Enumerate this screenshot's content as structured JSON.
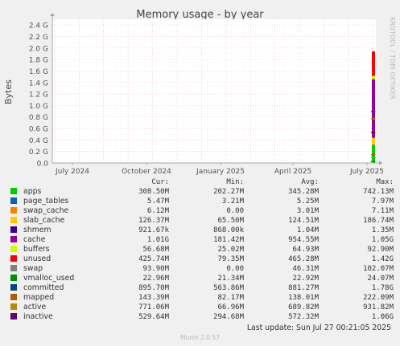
{
  "header": {
    "title": "Memory usage - by year",
    "side_text": "RRDTOOL / TOBI OETIKER",
    "ylabel": "Bytes"
  },
  "colors": {
    "apps": "#00cc00",
    "page_tables": "#0066b3",
    "swap_cache": "#ff8000",
    "slab_cache": "#ffcc00",
    "shmem": "#330099",
    "cache": "#990099",
    "buffers": "#ccff00",
    "unused": "#ff0000",
    "swap": "#808080",
    "vmalloc_used": "#008f00",
    "committed": "#00487d",
    "mapped": "#b35a00",
    "active": "#b38f00",
    "inactive": "#6b006b"
  },
  "chart_data": {
    "type": "area",
    "title": "Memory usage - by year",
    "ylabel": "Bytes",
    "x_ticks": [
      "July 2024",
      "October 2024",
      "January 2025",
      "April 2025",
      "July 2025"
    ],
    "y_ticks": [
      "0.0",
      "0.2 G",
      "0.4 G",
      "0.6 G",
      "0.8 G",
      "1.0 G",
      "1.2 G",
      "1.4 G",
      "1.6 G",
      "1.8 G",
      "2.0 G",
      "2.2 G",
      "2.4 G"
    ],
    "ylim": [
      0,
      2.5
    ],
    "grid": true,
    "note": "Data only present in the last few days of the period; stacked areas appear as a thin spike at the right edge",
    "stacked_series_latest_G": [
      {
        "name": "apps",
        "value": 0.3085
      },
      {
        "name": "page_tables",
        "value": 0.0055
      },
      {
        "name": "swap_cache",
        "value": 0.0061
      },
      {
        "name": "slab_cache",
        "value": 0.1264
      },
      {
        "name": "shmem",
        "value": 0.0009
      },
      {
        "name": "cache",
        "value": 1.01
      },
      {
        "name": "buffers",
        "value": 0.0567
      },
      {
        "name": "unused",
        "value": 0.4257
      }
    ],
    "line_series_latest_G": [
      {
        "name": "swap",
        "value": 0.0939
      },
      {
        "name": "vmalloc_used",
        "value": 0.023
      },
      {
        "name": "committed",
        "value": 0.8957
      },
      {
        "name": "mapped",
        "value": 0.1434
      },
      {
        "name": "active",
        "value": 0.771
      },
      {
        "name": "inactive",
        "value": 0.5296
      }
    ]
  },
  "legend": {
    "headers": [
      "Cur:",
      "Min:",
      "Avg:",
      "Max:"
    ],
    "rows": [
      {
        "name": "apps",
        "color": "#00cc00",
        "cur": "308.50M",
        "min": "202.27M",
        "avg": "345.28M",
        "max": "742.13M"
      },
      {
        "name": "page_tables",
        "color": "#0066b3",
        "cur": "5.47M",
        "min": "3.21M",
        "avg": "5.25M",
        "max": "7.97M"
      },
      {
        "name": "swap_cache",
        "color": "#ff8000",
        "cur": "6.12M",
        "min": "0.00",
        "avg": "3.01M",
        "max": "7.11M"
      },
      {
        "name": "slab_cache",
        "color": "#ffcc00",
        "cur": "126.37M",
        "min": "65.50M",
        "avg": "124.51M",
        "max": "186.74M"
      },
      {
        "name": "shmem",
        "color": "#330099",
        "cur": "921.67k",
        "min": "868.00k",
        "avg": "1.04M",
        "max": "1.35M"
      },
      {
        "name": "cache",
        "color": "#990099",
        "cur": "1.01G",
        "min": "181.42M",
        "avg": "954.55M",
        "max": "1.05G"
      },
      {
        "name": "buffers",
        "color": "#ccff00",
        "cur": "56.68M",
        "min": "25.02M",
        "avg": "64.93M",
        "max": "92.90M"
      },
      {
        "name": "unused",
        "color": "#ff0000",
        "cur": "425.74M",
        "min": "79.35M",
        "avg": "465.28M",
        "max": "1.42G"
      },
      {
        "name": "swap",
        "color": "#808080",
        "cur": "93.90M",
        "min": "0.00",
        "avg": "46.31M",
        "max": "102.07M"
      },
      {
        "name": "vmalloc_used",
        "color": "#008f00",
        "cur": "22.96M",
        "min": "21.34M",
        "avg": "22.92M",
        "max": "24.07M"
      },
      {
        "name": "committed",
        "color": "#00487d",
        "cur": "895.70M",
        "min": "563.86M",
        "avg": "881.27M",
        "max": "1.78G"
      },
      {
        "name": "mapped",
        "color": "#b35a00",
        "cur": "143.39M",
        "min": "82.17M",
        "avg": "138.01M",
        "max": "222.09M"
      },
      {
        "name": "active",
        "color": "#b38f00",
        "cur": "771.06M",
        "min": "66.96M",
        "avg": "689.82M",
        "max": "931.82M"
      },
      {
        "name": "inactive",
        "color": "#6b006b",
        "cur": "529.64M",
        "min": "294.68M",
        "avg": "572.32M",
        "max": "1.06G"
      }
    ]
  },
  "footer": {
    "last_update": "Last update: Sun Jul 27 00:21:05 2025",
    "generator": "Munin 2.0.57"
  }
}
